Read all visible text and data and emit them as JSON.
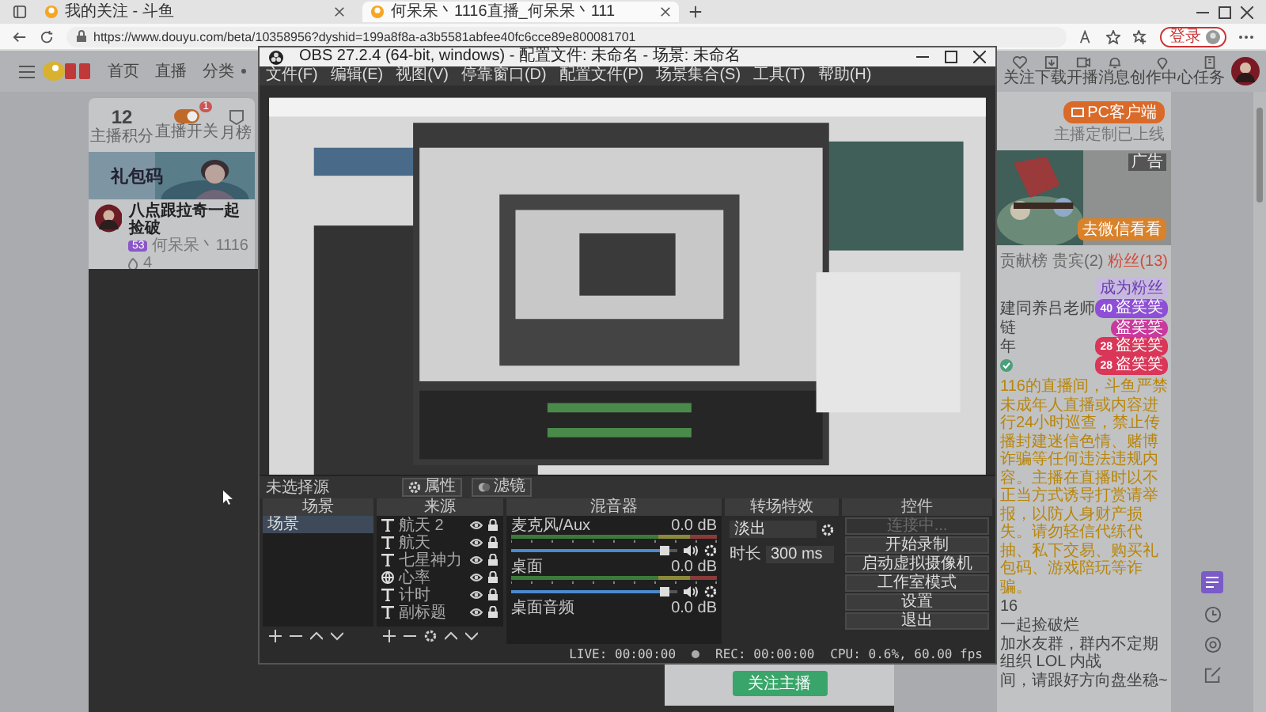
{
  "browser": {
    "tabs": [
      {
        "title": "我的关注 - 斗鱼",
        "selected": false
      },
      {
        "title": "何呆呆丶1116直播_何呆呆丶111",
        "selected": true
      }
    ],
    "url": "https://www.douyu.com/beta/10358956?dyshid=199a8f8a-a3b5581abfee40fc6cce89e800081701",
    "login": "登录"
  },
  "site": {
    "nav": [
      "首页",
      "直播",
      "分类"
    ],
    "header_icons": [
      {
        "kind": "heart",
        "label": "关注"
      },
      {
        "kind": "download",
        "label": "下载"
      },
      {
        "kind": "live",
        "label": "开播"
      },
      {
        "kind": "bell",
        "label": "消息"
      },
      {
        "kind": "pin",
        "label": "创作中心"
      },
      {
        "kind": "task",
        "label": "任务"
      }
    ],
    "stats": {
      "score": "12",
      "score_label": "主播积分",
      "switch_badge": "1",
      "switch_label": "直播开关",
      "rank_label": "月榜"
    },
    "banner_text": "礼包码",
    "room": {
      "title": "八点跟拉奇一起捡破",
      "level": "53",
      "streamer": "何呆呆丶1116",
      "hot": "4"
    },
    "follow_button": "关注主播",
    "side": {
      "client_button": "PC客户端",
      "client_note": "主播定制已上线",
      "ad_tag": "广告",
      "ad_button": "去微信看看",
      "tabs": [
        {
          "label": "贡献榜",
          "selected": false
        },
        {
          "label": "贵宾(2)",
          "selected": false
        },
        {
          "label": "粉丝(13)",
          "selected": true
        }
      ],
      "fan_button": "成为粉丝",
      "fans": [
        {
          "name": "建同养吕老师",
          "level": "40",
          "medal": "盗笑笑",
          "color": "#8e4fd6"
        },
        {
          "name": "链",
          "medal": "盗笑笑",
          "color": "#c93a9e"
        },
        {
          "name": "年",
          "level": "28",
          "medal": "盗笑笑",
          "color": "#d93658"
        },
        {
          "level": "28",
          "medal": "盗笑笑",
          "color": "#d93658"
        }
      ],
      "notice": "116的直播间，斗鱼严禁未成年人直播或内容进行24小时巡查，禁止传播封建迷信色情、赌博诈骗等任何违法违规内容。主播在直播时以不正当方式诱导打赏请举报，以防人身财产损失。请勿轻信代练代抽、私下交易、购买礼包码、游戏陪玩等诈骗。",
      "lines": [
        "16",
        "一起捡破烂",
        "加水友群，群内不定期组织 LOL 内战",
        "间，请跟好方向盘坐稳~"
      ]
    }
  },
  "obs": {
    "title": "OBS 27.2.4 (64-bit, windows) - 配置文件: 未命名 - 场景: 未命名",
    "menu": [
      "文件(F)",
      "编辑(E)",
      "视图(V)",
      "停靠窗口(D)",
      "配置文件(P)",
      "场景集合(S)",
      "工具(T)",
      "帮助(H)"
    ],
    "source_label": "未选择源",
    "source_buttons": [
      {
        "kind": "gear",
        "label": "属性"
      },
      {
        "kind": "filter",
        "label": "滤镜"
      }
    ],
    "dock_titles": [
      "场景",
      "来源",
      "混音器",
      "转场特效",
      "控件"
    ],
    "scenes": [
      {
        "name": "场景",
        "selected": true
      }
    ],
    "sources": [
      {
        "name": "航天 2",
        "kind": "text",
        "visible": true,
        "locked": true
      },
      {
        "name": "航天",
        "kind": "text",
        "visible": true,
        "locked": true
      },
      {
        "name": "七星神力",
        "kind": "text",
        "visible": true,
        "locked": true
      },
      {
        "name": "心率",
        "kind": "browser",
        "visible": true,
        "locked": true
      },
      {
        "name": "计时",
        "kind": "text",
        "visible": true,
        "locked": true
      },
      {
        "name": "副标题",
        "kind": "text",
        "visible": true,
        "locked": true
      }
    ],
    "mixer": [
      {
        "name": "麦克风/Aux",
        "db": "0.0 dB",
        "level": 0.92
      },
      {
        "name": "桌面",
        "db": "0.0 dB",
        "level": 0.92
      },
      {
        "name": "桌面音频",
        "db": "0.0 dB"
      }
    ],
    "transition": {
      "type": "淡出",
      "duration_label": "时长",
      "duration": "300 ms"
    },
    "controls": [
      {
        "label": "连接中...",
        "disabled": true
      },
      {
        "label": "开始录制",
        "disabled": false
      },
      {
        "label": "启动虚拟摄像机",
        "disabled": false
      },
      {
        "label": "工作室模式",
        "disabled": false
      },
      {
        "label": "设置",
        "disabled": false
      },
      {
        "label": "退出",
        "disabled": false
      }
    ],
    "status": {
      "live": "LIVE: 00:00:00",
      "rec": "REC: 00:00:00",
      "cpu": "CPU: 0.6%, 60.00 fps"
    }
  }
}
